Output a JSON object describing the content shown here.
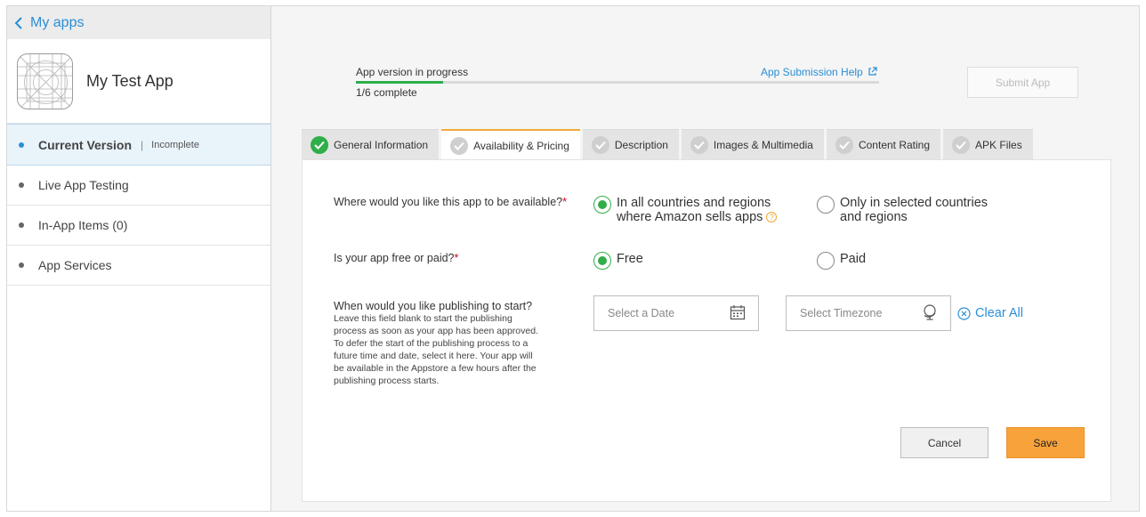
{
  "sidebar": {
    "back_label": "My apps",
    "app_name": "My Test App",
    "items": [
      {
        "label": "Current Version",
        "status": "Incomplete",
        "active": true
      },
      {
        "label": "Live App Testing"
      },
      {
        "label": "In-App Items (0)"
      },
      {
        "label": "App Services"
      }
    ]
  },
  "progress": {
    "title": "App version in progress",
    "count": "1/6 complete",
    "completed": 1,
    "total": 6,
    "help_link": "App Submission Help",
    "submit_label": "Submit App"
  },
  "tabs": [
    {
      "label": "General Information",
      "complete": true
    },
    {
      "label": "Availability & Pricing",
      "complete": false,
      "active": true
    },
    {
      "label": "Description",
      "complete": false
    },
    {
      "label": "Images & Multimedia",
      "complete": false
    },
    {
      "label": "Content Rating",
      "complete": false
    },
    {
      "label": "APK Files",
      "complete": false
    }
  ],
  "form": {
    "availability": {
      "question": "Where would you like this app to be available?",
      "option_all_line1": "In all countries and regions",
      "option_all_line2": "where Amazon sells apps",
      "option_selected_line1": "Only in selected countries",
      "option_selected_line2": "and regions",
      "selected": "all"
    },
    "pricing": {
      "question": "Is your app free or paid?",
      "option_free": "Free",
      "option_paid": "Paid",
      "selected": "free"
    },
    "publishing": {
      "question": "When would you like publishing to start?",
      "hint": "Leave this field blank to start the publishing process as soon as your app has been approved. To defer the start of the publishing process to a future time and date, select it here. Your app will be available in the Appstore a few hours after the publishing process starts.",
      "date_placeholder": "Select a Date",
      "timezone_placeholder": "Select Timezone",
      "clear_all": "Clear All"
    },
    "required_mark": "*",
    "cancel_label": "Cancel",
    "save_label": "Save"
  },
  "colors": {
    "accent_blue": "#2a8fd6",
    "success_green": "#2fae4a",
    "save_orange": "#f7a23b"
  }
}
